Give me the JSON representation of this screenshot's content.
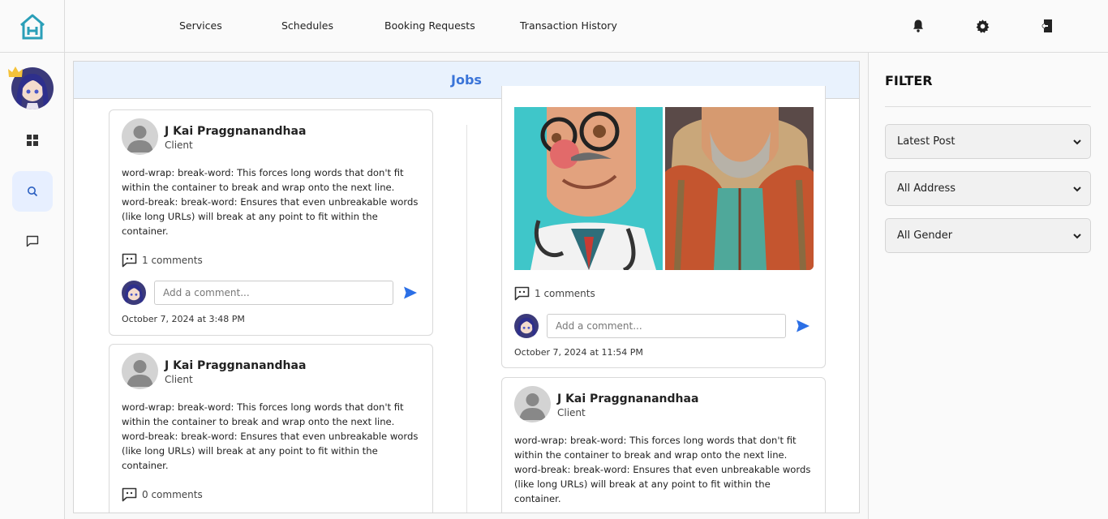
{
  "nav": {
    "items": [
      {
        "label": "Services"
      },
      {
        "label": "Schedules"
      },
      {
        "label": "Booking Requests"
      },
      {
        "label": "Transaction History"
      }
    ]
  },
  "icons": {
    "logo": "home-logo-icon",
    "notifications": "bell-icon",
    "settings": "gear-icon",
    "logout": "logout-icon",
    "dashboard": "grid-icon",
    "search": "search-icon",
    "messages": "chat-icon",
    "comments": "comment-icon",
    "send": "send-icon"
  },
  "colors": {
    "accent": "#3a74d8",
    "send": "#2b6fe6",
    "header_bg": "#e9f2fd",
    "active_bg": "#e7efff",
    "logo": "#2a9fb8"
  },
  "main": {
    "title": "Jobs",
    "posts": [
      {
        "name": "J Kai Praggnanandhaa",
        "role": "Client",
        "text": "word-wrap: break-word: This forces long words that don't fit within the container to break and wrap onto the next line. word-break: break-word: Ensures that even unbreakable words (like long URLs) will break at any point to fit within the container.",
        "comments": "1 comments",
        "comment_placeholder": "Add a comment...",
        "date": "October 7, 2024 at 3:48 PM"
      },
      {
        "name": "J Kai Praggnanandhaa",
        "role": "Client",
        "text": "word-wrap: break-word: This forces long words that don't fit within the container to break and wrap onto the next line. word-break: break-word: Ensures that even unbreakable words (like long URLs) will break at any point to fit within the container.",
        "comments": "0 comments"
      },
      {
        "comments": "1 comments",
        "comment_placeholder": "Add a comment...",
        "date": "October 7, 2024 at 11:54 PM"
      },
      {
        "name": "J Kai Praggnanandhaa",
        "role": "Client",
        "text": "word-wrap: break-word: This forces long words that don't fit within the container to break and wrap onto the next line. word-break: break-word: Ensures that even unbreakable words (like long URLs) will break at any point to fit within the container."
      }
    ]
  },
  "filter": {
    "title": "FILTER",
    "sort": "Latest Post",
    "address": "All Address",
    "gender": "All Gender"
  }
}
